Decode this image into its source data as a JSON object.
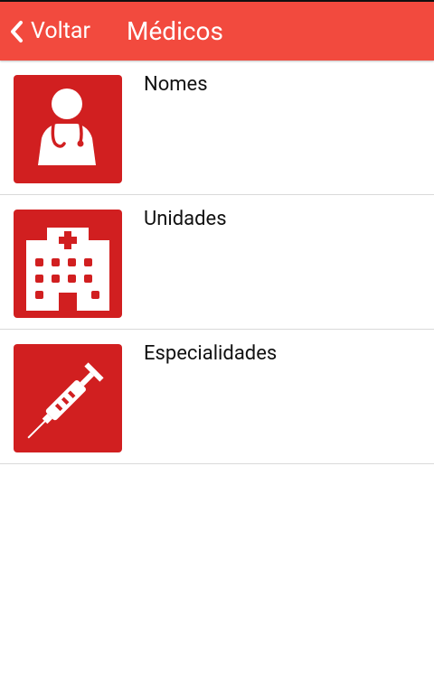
{
  "header": {
    "back_label": "Voltar",
    "title": "Médicos",
    "color": "#f24a3e"
  },
  "list": {
    "items": [
      {
        "label": "Nomes",
        "icon": "doctor-icon"
      },
      {
        "label": "Unidades",
        "icon": "hospital-icon"
      },
      {
        "label": "Especialidades",
        "icon": "syringe-icon"
      }
    ],
    "icon_background": "#d11f20"
  }
}
